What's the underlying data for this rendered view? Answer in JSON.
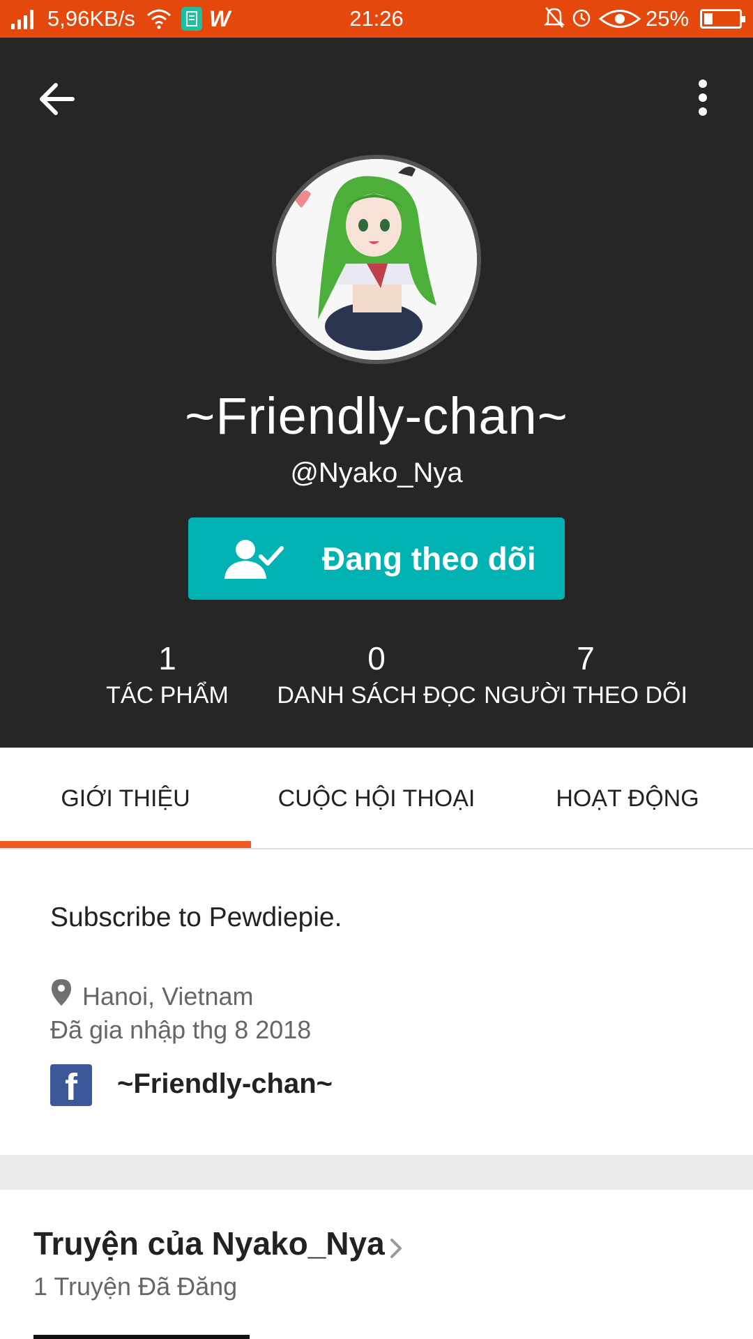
{
  "status_bar": {
    "network_speed": "5,96KB/s",
    "time": "21:26",
    "battery_percent": "25%",
    "battery_level": 0.25,
    "icons": [
      "signal-icon",
      "wifi-icon",
      "notes-app-icon",
      "wattpad-icon",
      "mute-icon",
      "alarm-icon",
      "eye-icon",
      "battery-icon"
    ]
  },
  "header": {
    "display_name": "~Friendly-chan~",
    "username": "@Nyako_Nya",
    "follow_button_label": "Đang theo dõi"
  },
  "stats": [
    {
      "value": "1",
      "label": "TÁC PHẨM"
    },
    {
      "value": "0",
      "label": "DANH SÁCH ĐỌC"
    },
    {
      "value": "7",
      "label": "NGƯỜI THEO DÕI"
    }
  ],
  "tabs": [
    {
      "label": "GIỚI THIỆU",
      "active": true
    },
    {
      "label": "CUỘC HỘI THOẠI",
      "active": false
    },
    {
      "label": "HOẠT ĐỘNG",
      "active": false
    }
  ],
  "about": {
    "bio": "Subscribe to Pewdiepie.",
    "location": "Hanoi, Vietnam",
    "joined": "Đã gia nhập thg 8 2018",
    "facebook_name": "~Friendly-chan~"
  },
  "stories": {
    "title": "Truyện của Nyako_Nya",
    "count_label": "1 Truyện Đã Đăng"
  },
  "colors": {
    "status_bar": "#e5480c",
    "header_bg": "#262626",
    "follow_button": "#00b2b2",
    "tab_indicator": "#f05a22",
    "facebook": "#3b5998"
  }
}
